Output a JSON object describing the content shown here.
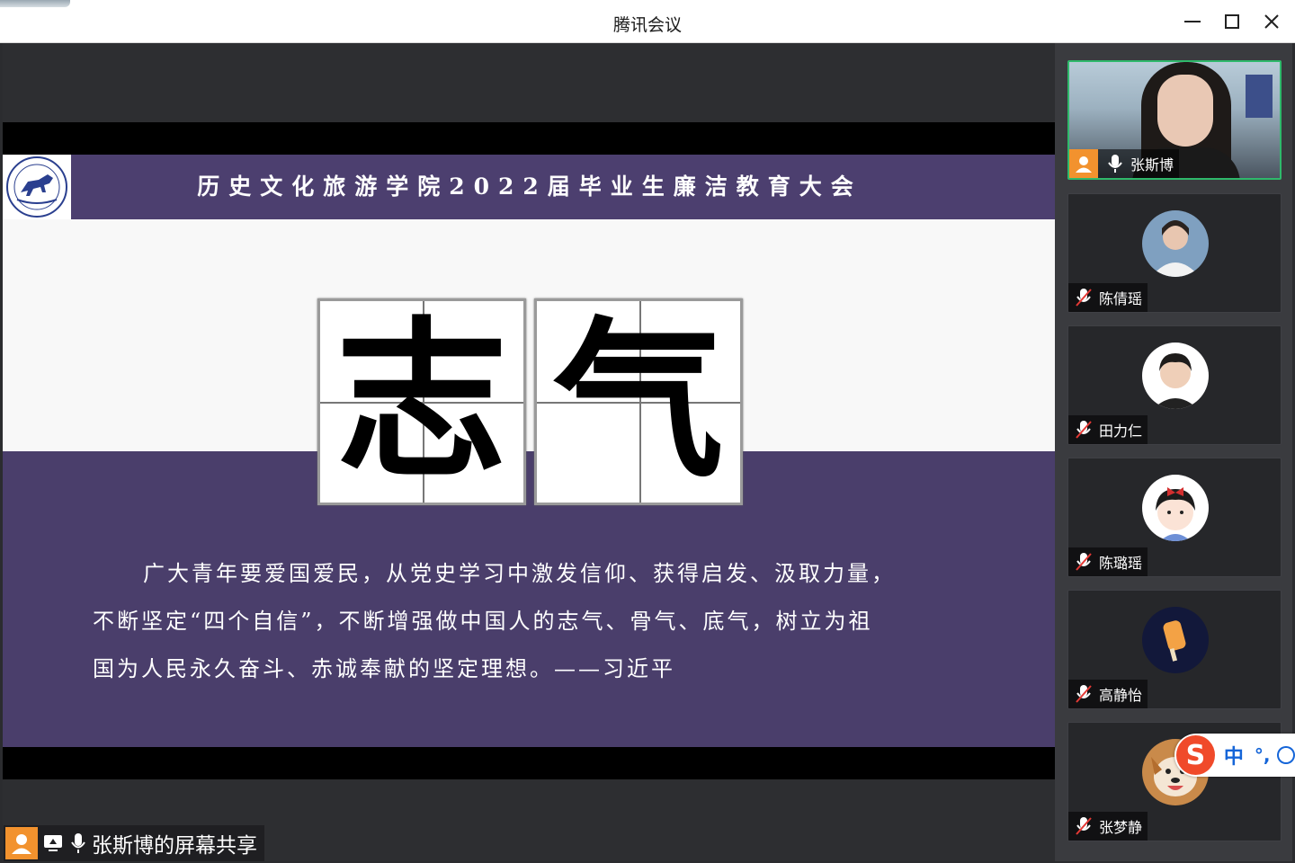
{
  "window": {
    "title": "腾讯会议"
  },
  "slide": {
    "banner_title": "历史文化旅游学院2022届毕业生廉洁教育大会",
    "calligraphy": [
      "志",
      "气"
    ],
    "quote_lines": [
      "广大青年要爱国爱民，从党史学习中激发信仰、获得启发、汲取力量，",
      "不断坚定“四个自信”，不断增强做中国人的志气、骨气、底气，树立为祖",
      "国为人民永久奋斗、赤诚奉献的坚定理想。——习近平"
    ]
  },
  "share_label": {
    "text": "张斯博的屏幕共享"
  },
  "participants": [
    {
      "name": "张斯博",
      "mic": "on",
      "video": true,
      "active": true
    },
    {
      "name": "陈倩瑶",
      "mic": "muted",
      "avatar_icon": "photo-avatar-icon"
    },
    {
      "name": "田力仁",
      "mic": "muted",
      "avatar_icon": "photo-avatar-icon"
    },
    {
      "name": "陈璐瑶",
      "mic": "muted",
      "avatar_icon": "cartoon-girl-avatar-icon"
    },
    {
      "name": "高静怡",
      "mic": "muted",
      "avatar_icon": "popsicle-avatar-icon"
    },
    {
      "name": "张梦静",
      "mic": "muted",
      "avatar_icon": "dog-avatar-icon"
    }
  ],
  "ime": {
    "lang": "中",
    "punct": "°,"
  },
  "colors": {
    "banner": "#4c3f6f",
    "active_border": "#2fb96b",
    "avatar_orange": "#f2922e"
  }
}
